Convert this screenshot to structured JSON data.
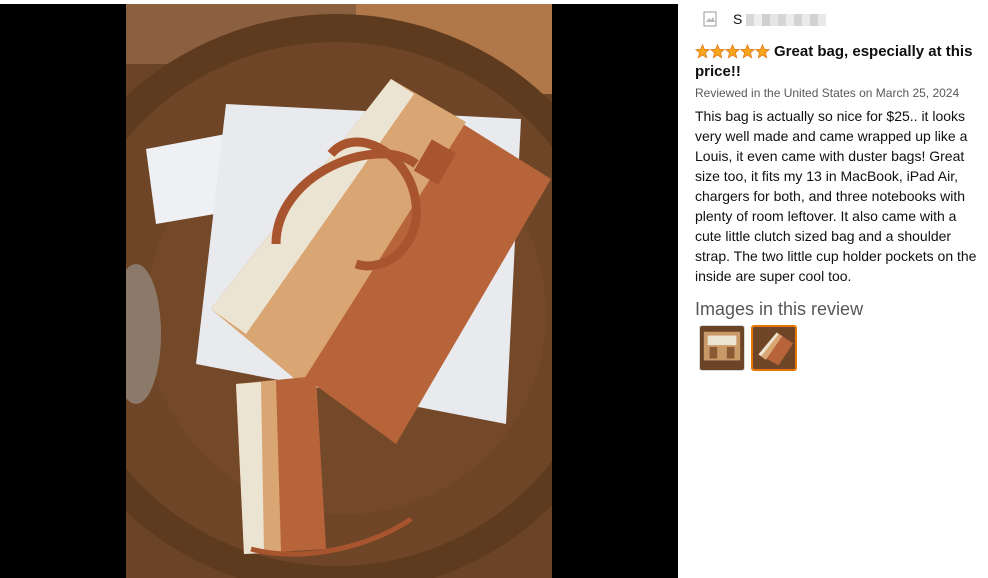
{
  "viewer": {
    "photo_description_icon": "photo-of-bag-set"
  },
  "review": {
    "reviewer_name": "S",
    "rating": 5,
    "rating_max": 5,
    "star_color": "#f4a51c",
    "title": "Great bag, especially at this price!!",
    "meta": "Reviewed in the United States on March 25, 2024",
    "body": "This bag is actually so nice for $25.. it looks very well made and came wrapped up like a Louis, it even came with duster bags! Great size too, it fits my 13 in MacBook, iPad Air, chargers for both, and three notebooks with plenty of room leftover. It also came with a cute little clutch sized bag and a shoulder strap. The two little cup holder pockets on the inside are super cool too.",
    "images_heading": "Images in this review",
    "thumbnails": [
      {
        "icon": "bag-interior-photo",
        "selected": false
      },
      {
        "icon": "bag-exterior-photo",
        "selected": true
      }
    ],
    "selected_accent": "#e77600"
  }
}
